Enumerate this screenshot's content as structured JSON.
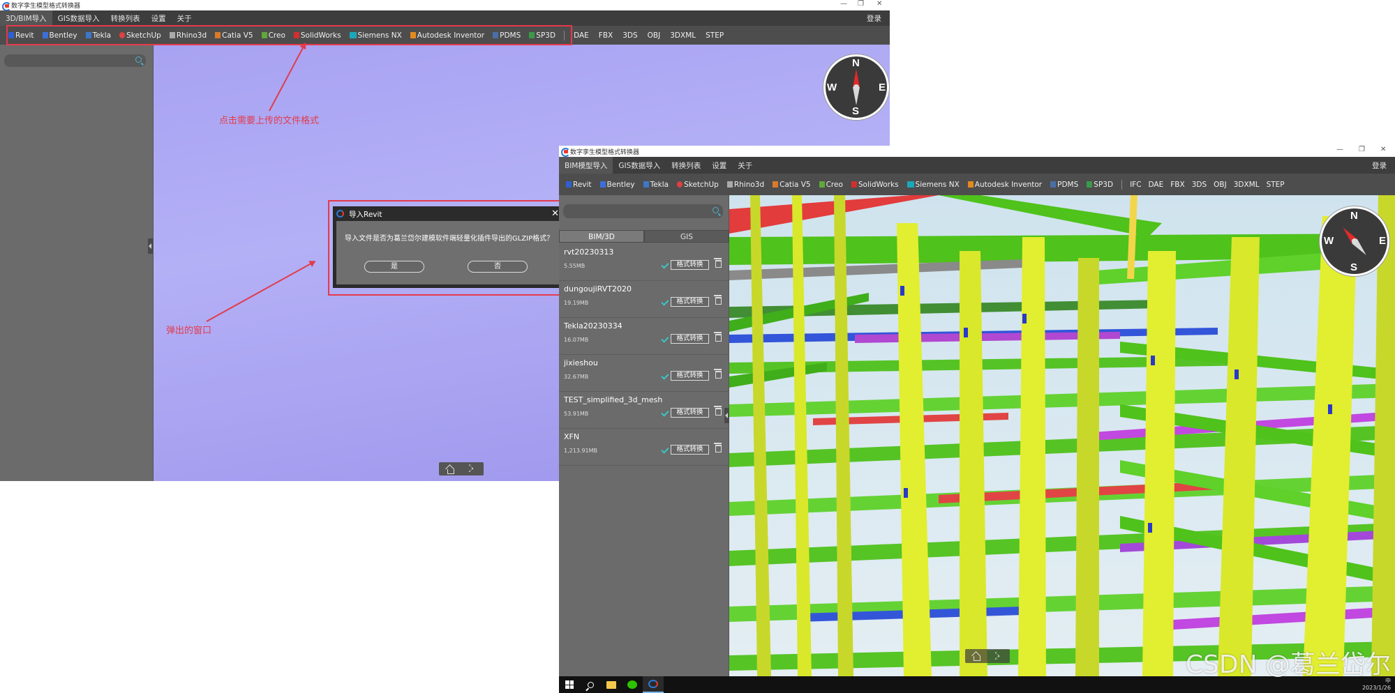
{
  "window_back": {
    "title": "数字孪生模型格式转换器",
    "window_controls": [
      "—",
      "❐",
      "✕"
    ],
    "menu": [
      "3D/BIM导入",
      "GIS数据导入",
      "转换列表",
      "设置",
      "关于"
    ],
    "login": "登录",
    "formats": [
      "Revit",
      "Bentley",
      "Tekla",
      "SketchUp",
      "Rhino3d",
      "Catia V5",
      "Creo",
      "SolidWorks",
      "Siemens NX",
      "Autodesk Inventor",
      "PDMS",
      "SP3D"
    ],
    "file_formats": [
      "DAE",
      "FBX",
      "3DS",
      "OBJ",
      "3DXML",
      "STEP"
    ],
    "search": {
      "placeholder": ""
    },
    "compass": {
      "n": "N",
      "s": "S",
      "w": "W",
      "e": "E"
    },
    "dialog": {
      "title": "导入Revit",
      "message": "导入文件是否为葛兰岱尔建模软件端轻量化插件导出的GLZIP格式？",
      "yes": "是",
      "no": "否",
      "close": "✕"
    }
  },
  "annotations": {
    "formats_hint": "点击需要上传的文件格式",
    "dialog_hint": "弹出的窗口"
  },
  "window_front": {
    "title": "数字孪生模型格式转换器",
    "window_controls": [
      "—",
      "❐",
      "✕"
    ],
    "menu": [
      "BIM模型导入",
      "GIS数据导入",
      "转换列表",
      "设置",
      "关于"
    ],
    "login": "登录",
    "formats": [
      "Revit",
      "Bentley",
      "Tekla",
      "SketchUp",
      "Rhino3d",
      "Catia V5",
      "Creo",
      "SolidWorks",
      "Siemens NX",
      "Autodesk Inventor",
      "PDMS",
      "SP3D"
    ],
    "file_formats": [
      "IFC",
      "DAE",
      "FBX",
      "3DS",
      "OBJ",
      "3DXML",
      "STEP"
    ],
    "search": {
      "placeholder": ""
    },
    "tabs": [
      "BIM/3D",
      "GIS"
    ],
    "convert_label": "格式转换",
    "files": [
      {
        "name": "rvt20230313",
        "size": "5.55MB"
      },
      {
        "name": "dungoujiRVT2020",
        "size": "19.19MB"
      },
      {
        "name": "Tekla20230334",
        "size": "16.07MB"
      },
      {
        "name": "jixieshou",
        "size": "32.67MB"
      },
      {
        "name": "TEST_simplified_3d_mesh",
        "size": "53.91MB"
      },
      {
        "name": "XFN",
        "size": "1,213.91MB"
      }
    ],
    "compass": {
      "n": "N",
      "s": "S",
      "w": "W",
      "e": "E"
    },
    "tray": {
      "time": "",
      "date": "2023/1/26",
      "ime": "中"
    }
  },
  "watermark": "CSDN @葛兰岱尔",
  "colors": {
    "annotation_red": "#e23b4c",
    "viewport_purple": "#a8a2f2",
    "check_cyan": "#3ac6c6",
    "steel_green": "#4fc21b",
    "column_yellow": "#d9e82a"
  }
}
